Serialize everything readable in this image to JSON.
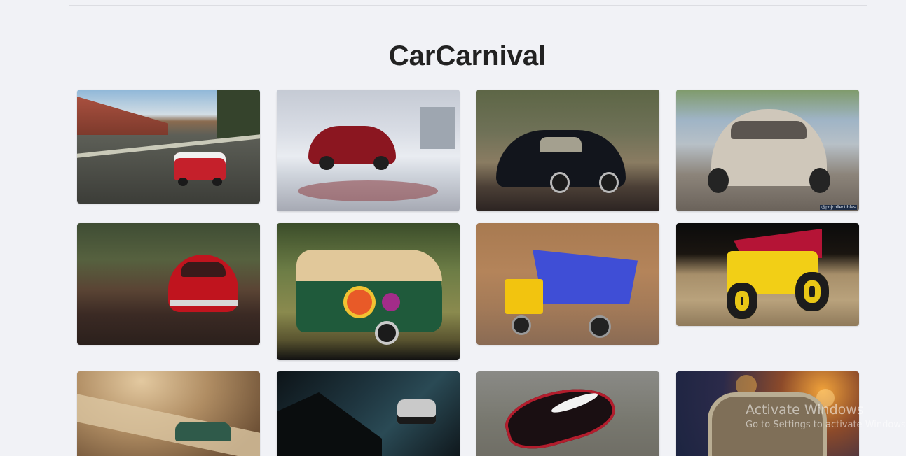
{
  "page": {
    "title": "CarCarnival"
  },
  "gallery": {
    "cards": [
      {
        "name": "photo-red-mini-on-road",
        "subject": "red-mini-car"
      },
      {
        "name": "photo-red-beetle-in-snow",
        "subject": "red-beetle"
      },
      {
        "name": "photo-black-beetle",
        "subject": "black-beetle"
      },
      {
        "name": "photo-white-beetle",
        "subject": "white-beetle"
      },
      {
        "name": "photo-red-beetle-forest",
        "subject": "red-beetle"
      },
      {
        "name": "photo-hippie-van",
        "subject": "vw-van"
      },
      {
        "name": "photo-blue-dump-truck",
        "subject": "dump-truck"
      },
      {
        "name": "photo-yellow-dump-truck",
        "subject": "dump-truck"
      },
      {
        "name": "photo-green-car-sepia",
        "subject": "green-car"
      },
      {
        "name": "photo-rally-car-dark",
        "subject": "rally-car"
      },
      {
        "name": "photo-red-black-sports-car",
        "subject": "sports-car"
      },
      {
        "name": "photo-vintage-toy-car-bokeh",
        "subject": "vintage-car"
      }
    ],
    "photo_credit": "@pnjcollectibles"
  },
  "os_watermark": {
    "title": "Activate Windows",
    "subtitle": "Go to Settings to activate Windows."
  }
}
